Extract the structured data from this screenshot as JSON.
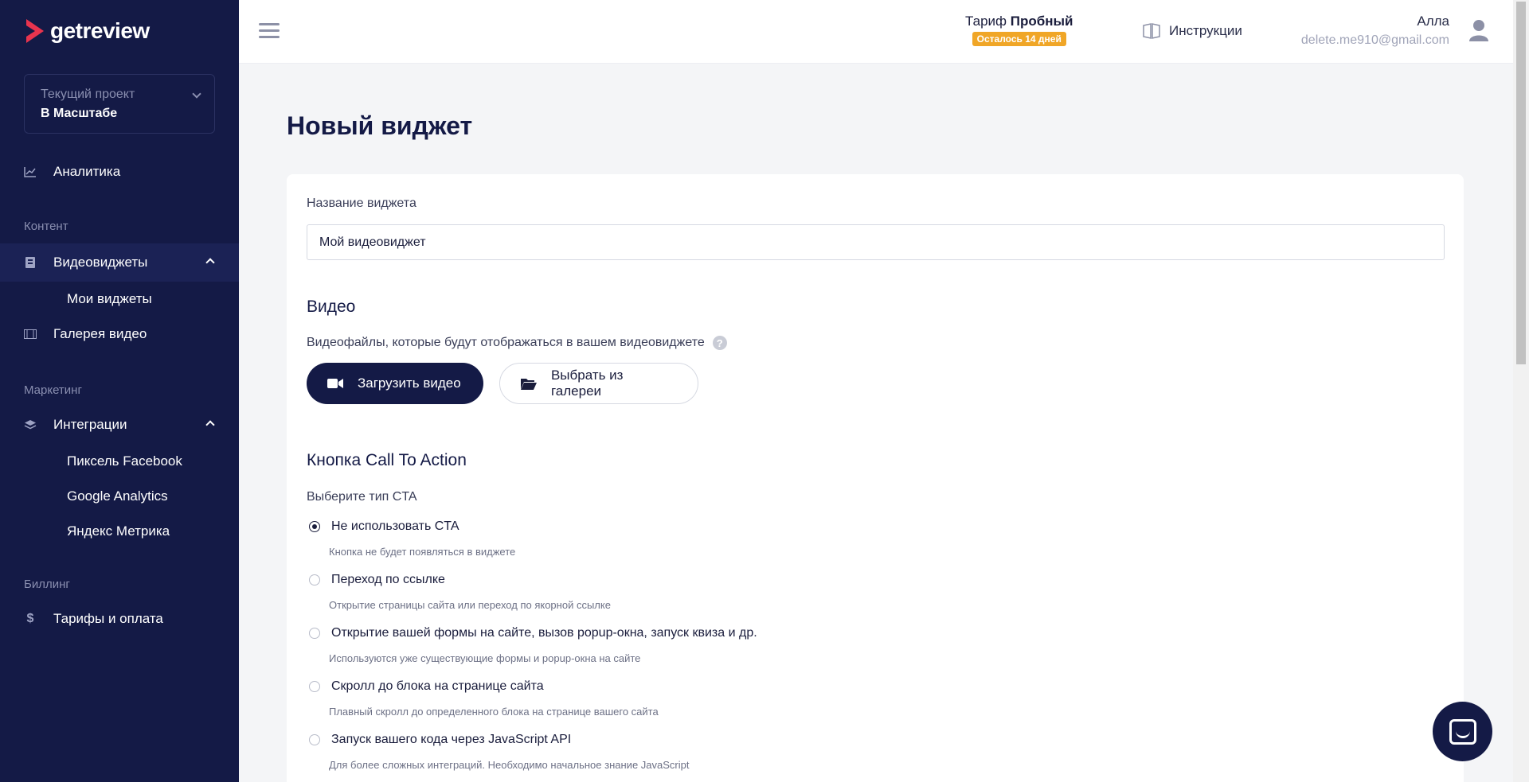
{
  "app": {
    "name": "getreview"
  },
  "sidebar": {
    "project": {
      "label": "Текущий проект",
      "name": "В Масштабе"
    },
    "items": [
      {
        "label": "Аналитика",
        "icon": "chart-line-icon"
      },
      {
        "label": "Видеовиджеты",
        "icon": "video-widget-icon"
      },
      {
        "label": "Галерея видео",
        "icon": "film-icon"
      },
      {
        "label": "Интеграции",
        "icon": "layers-icon"
      },
      {
        "label": "Тарифы и оплата",
        "icon": "dollar-icon"
      }
    ],
    "sections": {
      "content": "Контент",
      "marketing": "Маркетинг",
      "billing": "Биллинг"
    },
    "sub": {
      "my_widgets": "Мои виджеты",
      "pixel_facebook": "Пиксель Facebook",
      "google_analytics": "Google Analytics",
      "yandex_metrica": "Яндекс Метрика"
    }
  },
  "header": {
    "tariff_prefix": "Тариф",
    "tariff_name": "Пробный",
    "tariff_badge": "Осталось 14 дней",
    "instructions": "Инструкции",
    "user_name": "Алла",
    "user_email": "delete.me910@gmail.com"
  },
  "page": {
    "title": "Новый виджет",
    "widget_name_label": "Название виджета",
    "widget_name_value": "Мой видеовиджет",
    "video_title": "Видео",
    "video_help": "Видеофайлы, которые будут отображаться в вашем видеовиджете",
    "upload_button": "Загрузить видео",
    "gallery_button": "Выбрать из галереи",
    "cta_title": "Кнопка Call To Action",
    "cta_type_label": "Выберите тип CTA",
    "cta_options": [
      {
        "label": "Не использовать CTA",
        "desc": "Кнопка не будет появляться в виджете",
        "checked": true
      },
      {
        "label": "Переход по ссылке",
        "desc": "Открытие страницы сайта или переход по якорной ссылке",
        "checked": false
      },
      {
        "label": "Открытие вашей формы на сайте, вызов popup-окна, запуск квиза и др.",
        "desc": "Используются уже существующие формы и popup-окна на сайте",
        "checked": false
      },
      {
        "label": "Скролл до блока на странице сайта",
        "desc": "Плавный скролл до определенного блока на странице вашего сайта",
        "checked": false
      },
      {
        "label": "Запуск вашего кода через JavaScript API",
        "desc": "Для более сложных интеграций. Необходимо начальное знание JavaScript",
        "checked": false
      }
    ]
  },
  "colors": {
    "sidebar_bg": "#141a46",
    "accent": "#141a46",
    "badge": "#f0a627",
    "logo_red": "#e8344e"
  }
}
